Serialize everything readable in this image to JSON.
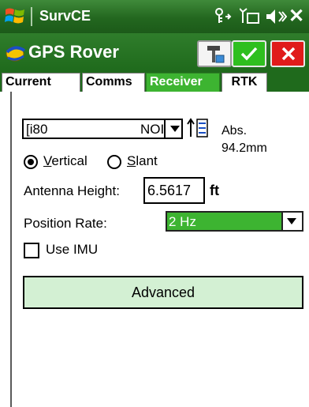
{
  "titlebar": {
    "app_name": "SurvCE",
    "icons": [
      "windows-flag-icon",
      "network-icon",
      "sync-icon",
      "volume-icon"
    ],
    "close_glyph": "✕"
  },
  "header": {
    "title": "GPS Rover",
    "buttons": [
      "instrument-icon",
      "check-icon",
      "close-icon"
    ]
  },
  "tabs": [
    {
      "label": "Current",
      "active": false
    },
    {
      "label": "Comms",
      "active": false
    },
    {
      "label": "Receiver",
      "active": true
    },
    {
      "label": "RTK",
      "active": false
    }
  ],
  "receiver": {
    "model_value": "[i80",
    "model_suffix": "NOI",
    "abs_label": "Abs.",
    "abs_value": "94.2mm"
  },
  "measure_type": {
    "vertical_label": "Vertical",
    "vertical_accel": "V",
    "slant_label": "Slant",
    "slant_accel": "S",
    "selected": "vertical"
  },
  "antenna_height": {
    "label": "Antenna Height:",
    "value": "6.5617",
    "unit": "ft"
  },
  "position_rate": {
    "label": "Position Rate:",
    "value": "2 Hz"
  },
  "use_imu": {
    "label": "Use IMU",
    "checked": false
  },
  "advanced_button": {
    "label": "Advanced"
  },
  "colors": {
    "header_green": "#23671f",
    "highlight_green": "#3db431",
    "advanced_bg": "#d3f0d3",
    "ok_green": "#2fbf1f",
    "cancel_red": "#e01b1b"
  }
}
